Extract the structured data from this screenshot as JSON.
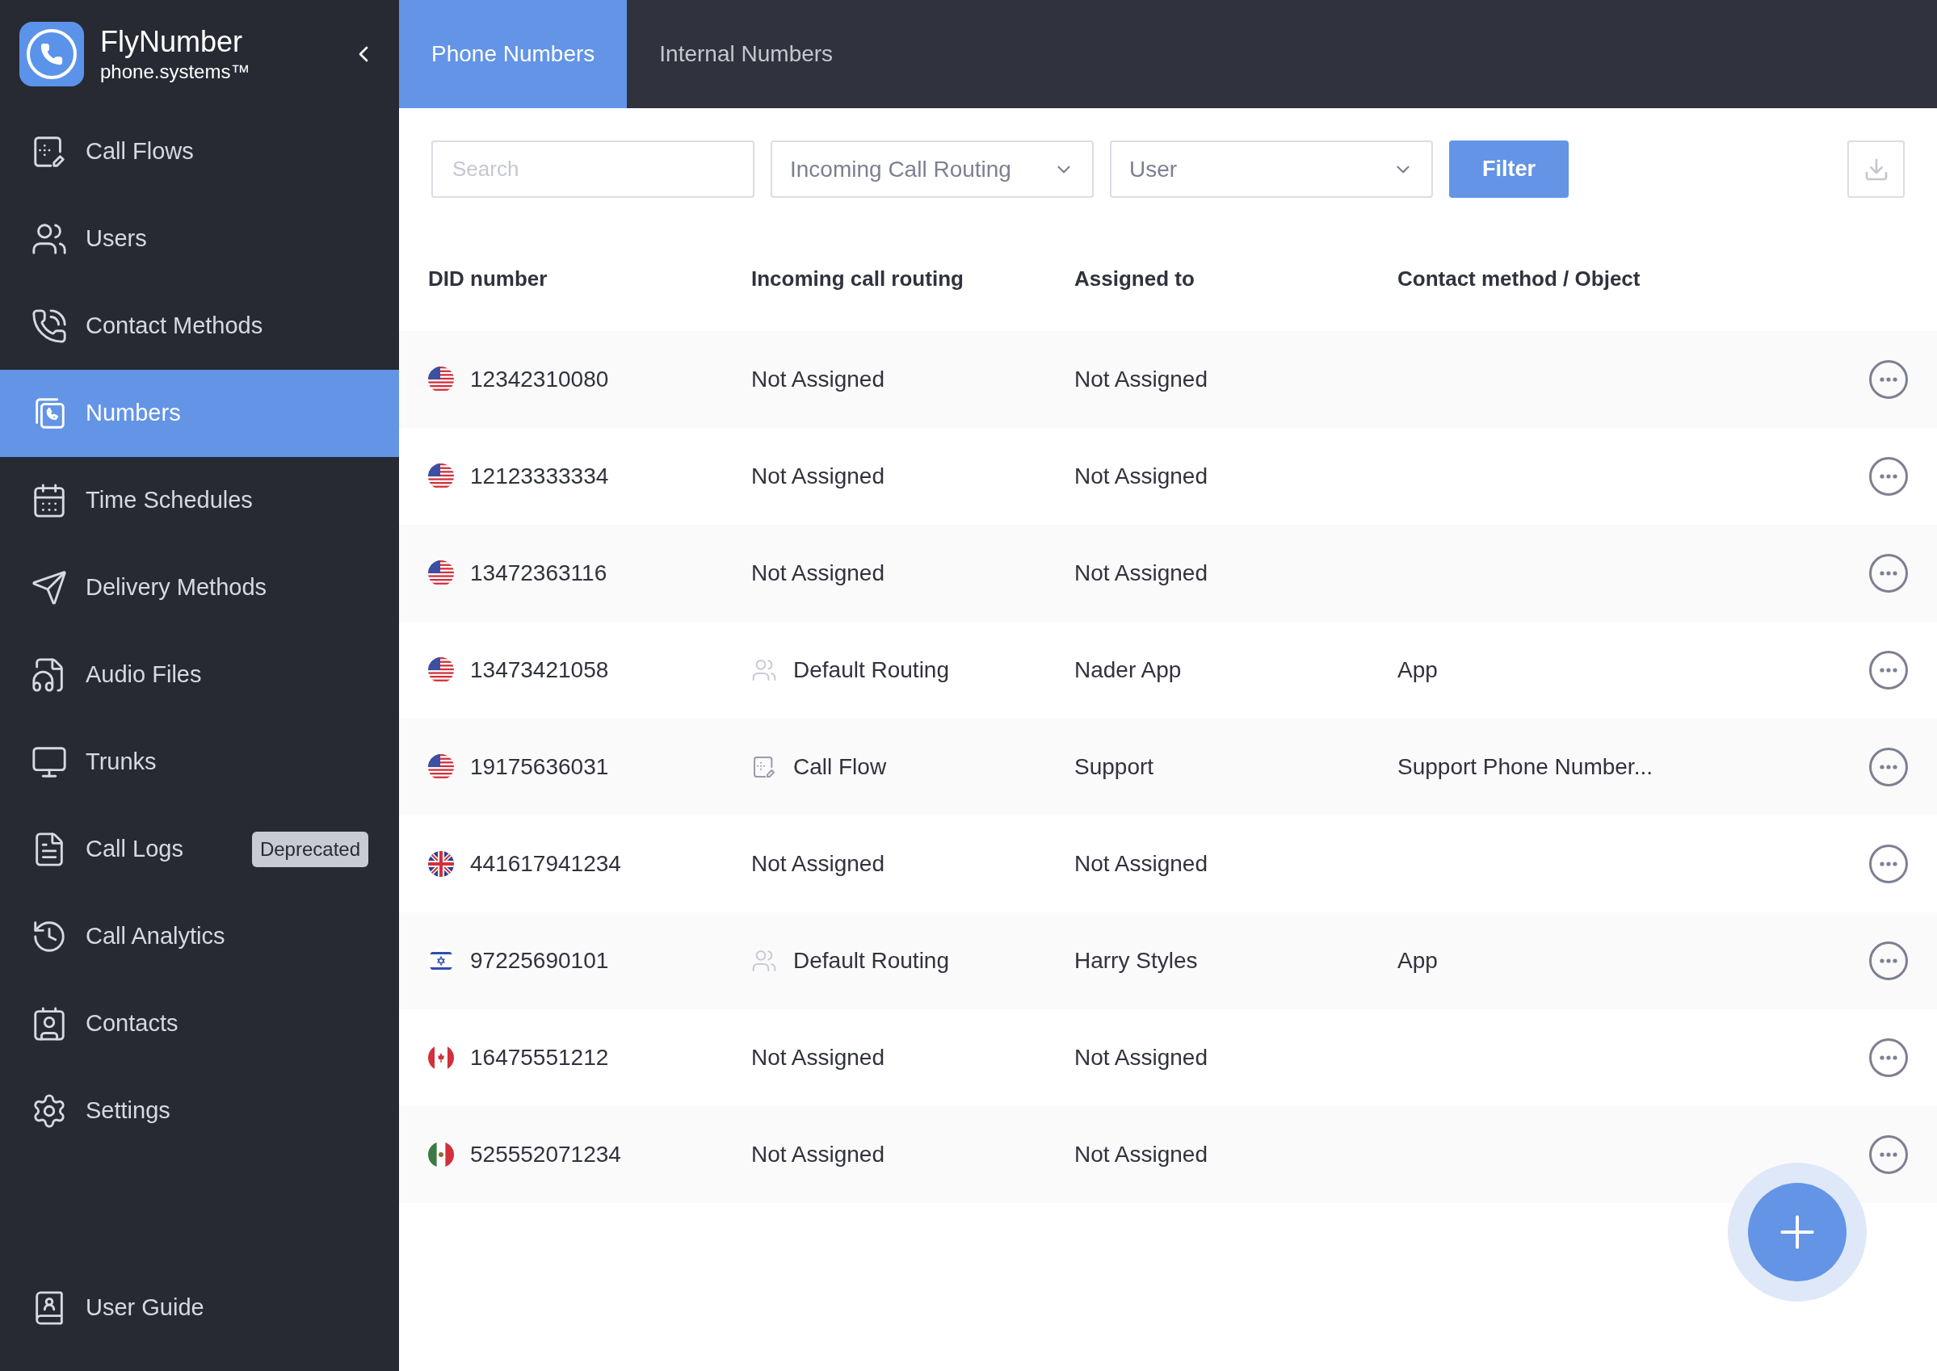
{
  "brand": {
    "name": "FlyNumber",
    "tagline": "phone.systems™"
  },
  "nav": [
    {
      "label": "Call Flows",
      "selected": false
    },
    {
      "label": "Users",
      "selected": false
    },
    {
      "label": "Contact Methods",
      "selected": false
    },
    {
      "label": "Numbers",
      "selected": true
    },
    {
      "label": "Time Schedules",
      "selected": false
    },
    {
      "label": "Delivery Methods",
      "selected": false
    },
    {
      "label": "Audio Files",
      "selected": false
    },
    {
      "label": "Trunks",
      "selected": false
    },
    {
      "label": "Call Logs",
      "selected": false,
      "badge": "Deprecated"
    },
    {
      "label": "Call Analytics",
      "selected": false
    },
    {
      "label": "Contacts",
      "selected": false
    },
    {
      "label": "Settings",
      "selected": false
    }
  ],
  "footer_nav": {
    "label": "User Guide"
  },
  "tabs": [
    {
      "label": "Phone Numbers",
      "selected": true
    },
    {
      "label": "Internal Numbers",
      "selected": false
    }
  ],
  "filters": {
    "search": {
      "placeholder": "Search"
    },
    "routing": {
      "value": "Incoming Call Routing"
    },
    "user": {
      "value": "User"
    },
    "filter_button": "Filter"
  },
  "table": {
    "columns": [
      "DID number",
      "Incoming call routing",
      "Assigned to",
      "Contact method / Object"
    ],
    "rows": [
      {
        "flag": {
          "kind": "us"
        },
        "did": "12342310080",
        "routing": {
          "text": "Not Assigned"
        },
        "assigned": "Not Assigned"
      },
      {
        "flag": {
          "kind": "us"
        },
        "did": "12123333334",
        "routing": {
          "text": "Not Assigned"
        },
        "assigned": "Not Assigned"
      },
      {
        "flag": {
          "kind": "us"
        },
        "did": "13472363116",
        "routing": {
          "text": "Not Assigned"
        },
        "assigned": "Not Assigned"
      },
      {
        "flag": {
          "kind": "us"
        },
        "did": "13473421058",
        "routing": {
          "kind": "users",
          "text": "Default Routing"
        },
        "assigned": "Nader App",
        "contact": "App"
      },
      {
        "flag": {
          "kind": "us"
        },
        "did": "19175636031",
        "routing": {
          "kind": "flow",
          "text": "Call Flow"
        },
        "assigned": "Support",
        "contact": "Support Phone Number..."
      },
      {
        "flag": {
          "kind": "gb"
        },
        "did": "441617941234",
        "routing": {
          "text": "Not Assigned"
        },
        "assigned": "Not Assigned"
      },
      {
        "flag": {
          "kind": "il"
        },
        "did": "97225690101",
        "routing": {
          "kind": "users",
          "text": "Default Routing"
        },
        "assigned": "Harry Styles",
        "contact": "App"
      },
      {
        "flag": {
          "kind": "ca"
        },
        "did": "16475551212",
        "routing": {
          "text": "Not Assigned"
        },
        "assigned": "Not Assigned"
      },
      {
        "flag": {
          "kind": "mx"
        },
        "did": "525552071234",
        "routing": {
          "text": "Not Assigned"
        },
        "assigned": "Not Assigned"
      }
    ]
  }
}
